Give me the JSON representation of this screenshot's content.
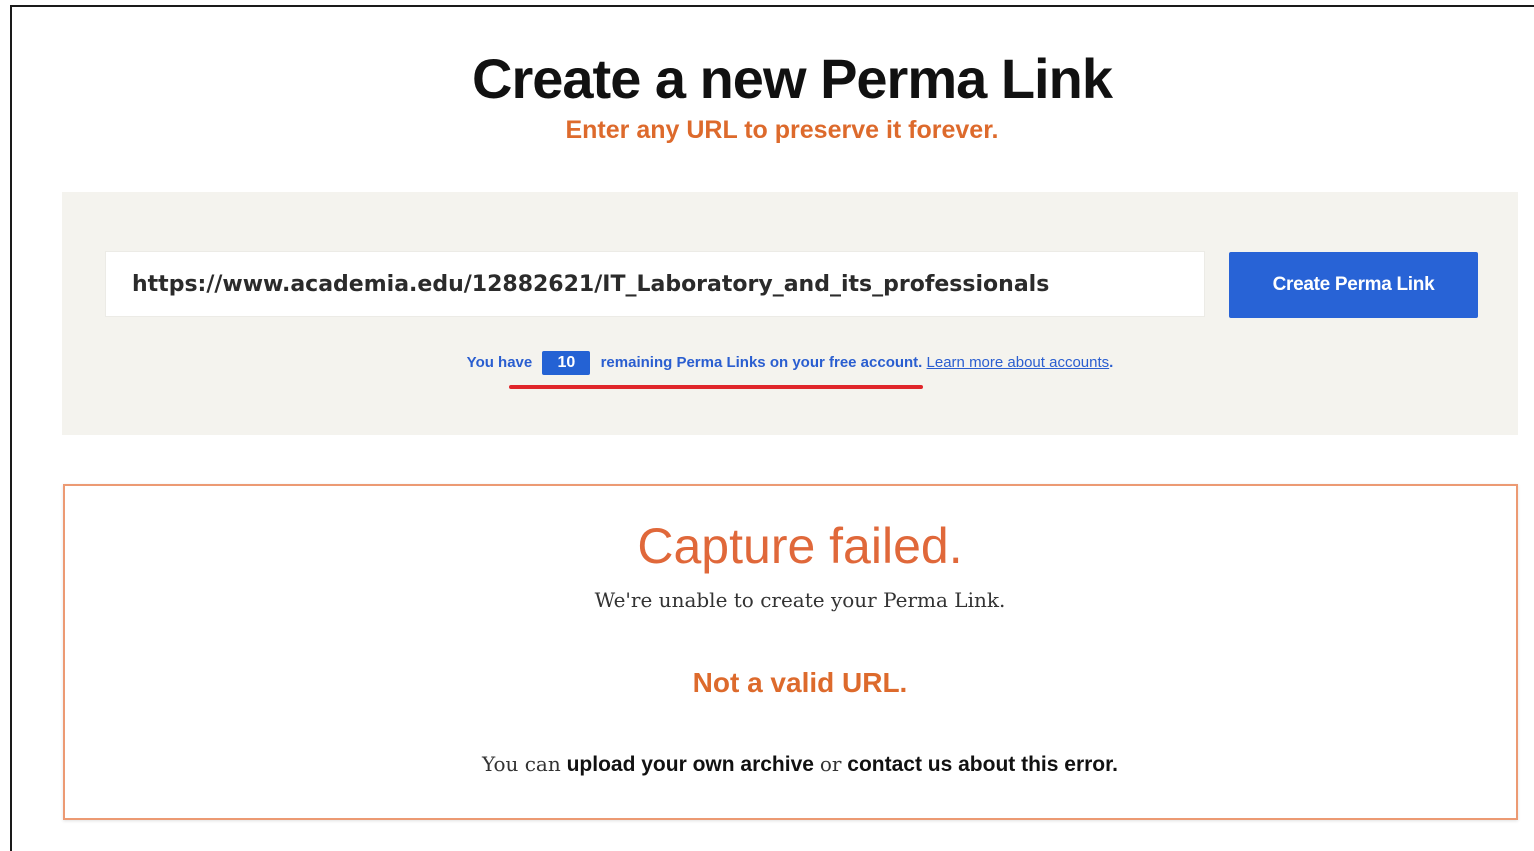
{
  "header": {
    "title": "Create a new Perma Link",
    "subtitle": "Enter any URL to preserve it forever."
  },
  "create_form": {
    "url_value": "https://www.academia.edu/12882621/IT_Laboratory_and_its_professionals",
    "submit_label": "Create Perma Link"
  },
  "quota": {
    "prefix": "You have",
    "remaining_count": "10",
    "suffix": "remaining Perma Links on your free account.",
    "learn_more_label": "Learn more about accounts",
    "trailing": "."
  },
  "error": {
    "title": "Capture failed.",
    "message": "We're unable to create your Perma Link.",
    "detail": "Not a valid URL.",
    "help_prefix": "You can",
    "upload_link": "upload your own archive",
    "help_middle": "or",
    "contact_link": "contact us about this error",
    "help_suffix": "."
  },
  "colors": {
    "accent_orange": "#dd6a2c",
    "brand_blue": "#2863d6",
    "annotation_red": "#e0252a",
    "panel_bg": "#f4f3ee"
  }
}
